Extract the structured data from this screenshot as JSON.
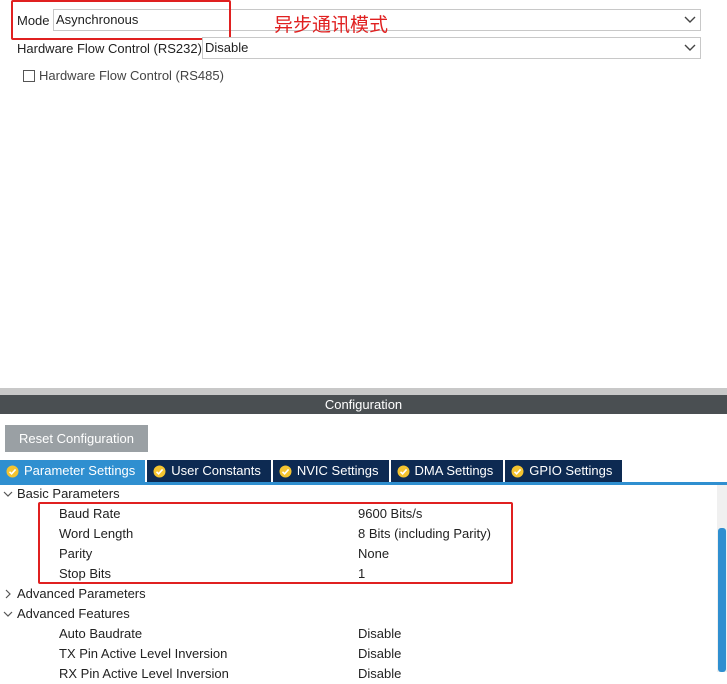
{
  "mode": {
    "label": "Mode",
    "value": "Asynchronous",
    "annotation": "异步通讯模式"
  },
  "hw_flow_rs232": {
    "label": "Hardware Flow Control (RS232)",
    "value": "Disable"
  },
  "hw_flow_rs485": {
    "label": "Hardware Flow Control (RS485)",
    "checked": false
  },
  "configuration": {
    "title": "Configuration",
    "reset_label": "Reset Configuration"
  },
  "tabs": [
    {
      "label": "Parameter Settings",
      "active": true
    },
    {
      "label": "User Constants",
      "active": false
    },
    {
      "label": "NVIC Settings",
      "active": false
    },
    {
      "label": "DMA Settings",
      "active": false
    },
    {
      "label": "GPIO Settings",
      "active": false
    }
  ],
  "tree": {
    "basic": {
      "label": "Basic Parameters",
      "expanded": true,
      "items": [
        {
          "name": "Baud Rate",
          "value": "9600 Bits/s"
        },
        {
          "name": "Word Length",
          "value": "8 Bits (including Parity)"
        },
        {
          "name": "Parity",
          "value": "None"
        },
        {
          "name": "Stop Bits",
          "value": "1"
        }
      ]
    },
    "advanced_params": {
      "label": "Advanced Parameters",
      "expanded": false
    },
    "advanced_features": {
      "label": "Advanced Features",
      "expanded": true,
      "items": [
        {
          "name": "Auto Baudrate",
          "value": "Disable"
        },
        {
          "name": "TX Pin Active Level Inversion",
          "value": "Disable"
        },
        {
          "name": "RX Pin Active Level Inversion",
          "value": "Disable"
        }
      ]
    }
  },
  "colors": {
    "accent": "#2f8fd0",
    "tab_bg": "#0d2a52",
    "annotation_red": "#e02020",
    "config_bar": "#4a4f52"
  }
}
